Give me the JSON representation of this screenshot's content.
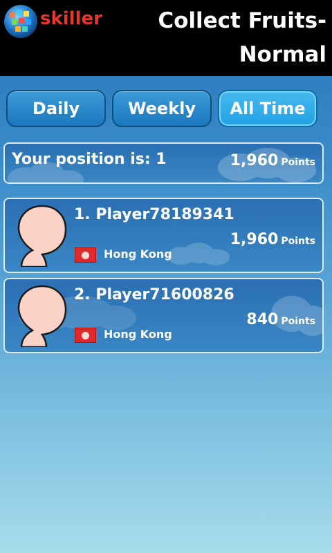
{
  "header": {
    "logo_text": "skiller",
    "title_line1": "Collect Fruits-",
    "title_line2": "Normal"
  },
  "tabs": [
    {
      "label": "Daily",
      "active": false
    },
    {
      "label": "Weekly",
      "active": false
    },
    {
      "label": "All Time",
      "active": true
    }
  ],
  "position": {
    "label": "Your position is: 1",
    "points_value": "1,960",
    "points_unit": "Points"
  },
  "leaderboard": [
    {
      "name": "1. Player78189341",
      "country": "Hong Kong",
      "points_value": "1,960",
      "points_unit": "Points"
    },
    {
      "name": "2. Player71600826",
      "country": "Hong Kong",
      "points_value": "840",
      "points_unit": "Points"
    }
  ],
  "colors": {
    "header_bg": "#000000",
    "logo_red": "#e8352e",
    "tab_active": "#21a2e6",
    "tab_inactive": "#1b78bd"
  }
}
